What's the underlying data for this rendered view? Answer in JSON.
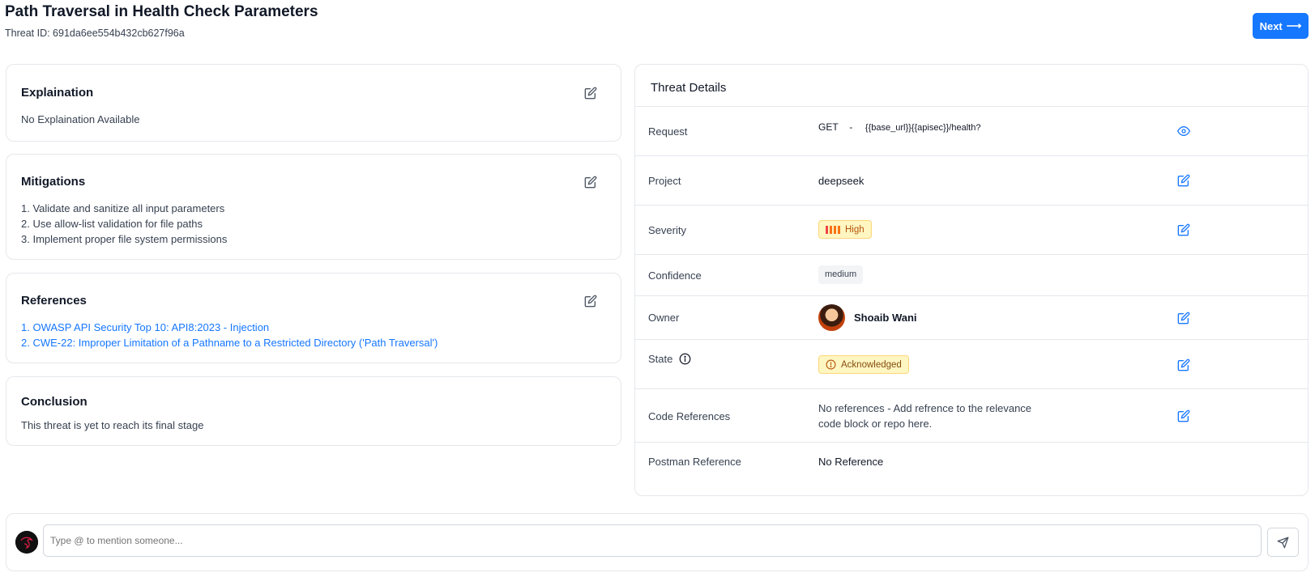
{
  "header": {
    "title": "Path Traversal in Health Check Parameters",
    "threat_id": "Threat ID: 691da6ee554b432cb627f96a",
    "next_label": "Next",
    "next_arrow": "⟶"
  },
  "cards": {
    "explanation": {
      "title": "Explaination",
      "body": "No Explaination Available"
    },
    "mitigations": {
      "title": "Mitigations",
      "items": [
        "1. Validate and sanitize all input parameters",
        "2. Use allow-list validation for file paths",
        "3. Implement proper file system permissions"
      ]
    },
    "references": {
      "title": "References",
      "items": [
        "1. OWASP API Security Top 10: API8:2023 - Injection",
        "2. CWE-22: Improper Limitation of a Pathname to a Restricted Directory ('Path Traversal')"
      ]
    },
    "conclusion": {
      "title": "Conclusion",
      "body": "This threat is yet to reach its final stage"
    }
  },
  "details": {
    "title": "Threat Details",
    "request": {
      "label": "Request",
      "method": "GET",
      "separator": "-",
      "url": "{{base_url}}{{apisec}}/health?"
    },
    "project": {
      "label": "Project",
      "value": "deepseek"
    },
    "severity": {
      "label": "Severity",
      "value": "High"
    },
    "confidence": {
      "label": "Confidence",
      "value": "medium"
    },
    "owner": {
      "label": "Owner",
      "name": "Shoaib Wani"
    },
    "state": {
      "label": "State",
      "value": "Acknowledged"
    },
    "code_references": {
      "label": "Code References",
      "value": "No references - Add refrence to the relevance code block or repo here."
    },
    "postman_reference": {
      "label": "Postman Reference",
      "value": "No Reference"
    }
  },
  "comment": {
    "placeholder": "Type @ to mention someone..."
  },
  "colors": {
    "primary": "#1677ff",
    "warning_bg": "#fff6c2",
    "warning_border": "#fcd77a"
  },
  "icons": {
    "edit": "edit-icon",
    "view": "eye-icon",
    "send": "send-icon",
    "info": "info-icon"
  }
}
